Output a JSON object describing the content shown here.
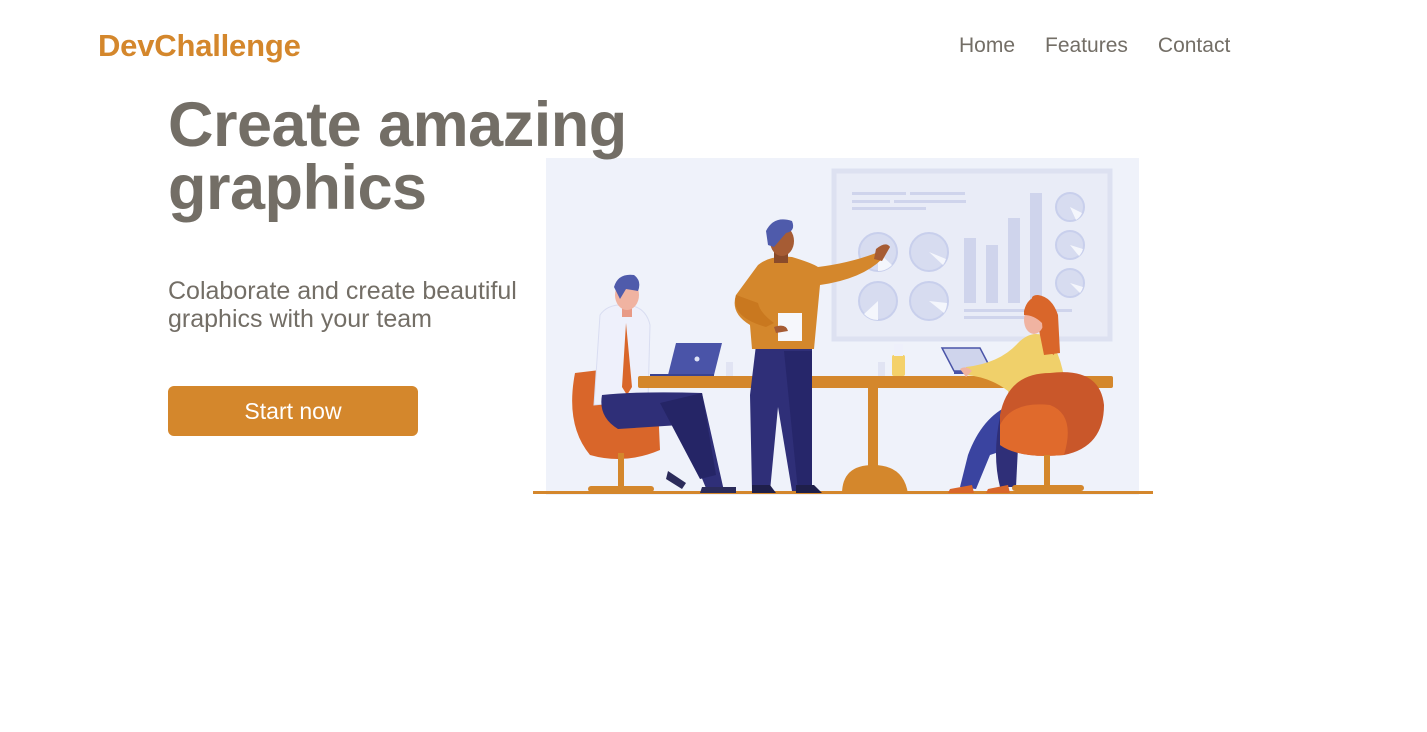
{
  "brand": {
    "name": "DevChallenge"
  },
  "nav": {
    "items": [
      {
        "label": "Home"
      },
      {
        "label": "Features"
      },
      {
        "label": "Contact"
      }
    ]
  },
  "hero": {
    "title_line1": "Create amazing",
    "title_line2": "graphics",
    "subtitle_line1": "Colaborate and create beautiful",
    "subtitle_line2": "graphics with your team",
    "cta_label": "Start now"
  },
  "colors": {
    "accent": "#d4872c",
    "text": "#736e66",
    "illustration_bg": "#eff2fa",
    "board": "#e2e6f4",
    "navy": "#2f2f78",
    "chair": "#d9662a"
  },
  "icons": [
    "team-meeting-illustration"
  ]
}
